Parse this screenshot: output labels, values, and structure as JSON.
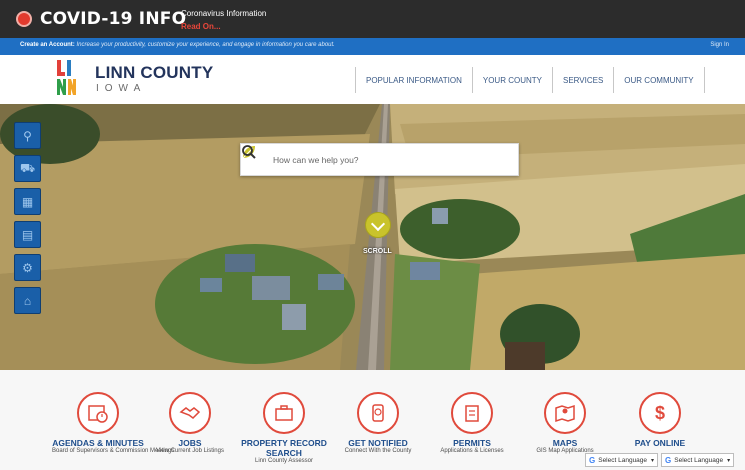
{
  "covid": {
    "title": "COVID-19 INFO",
    "subtitle": "Coronavirus Information",
    "link": "Read On..."
  },
  "account_bar": {
    "create_label": "Create an Account:",
    "message": "Increase your productivity, customize your experience, and engage in information you care about.",
    "sign_in": "Sign In"
  },
  "brand": {
    "name": "LINN COUNTY",
    "sub": "IOWA",
    "logo_letters": [
      "L",
      "I",
      "N",
      "N"
    ]
  },
  "nav": {
    "items": [
      {
        "label": "POPULAR INFORMATION"
      },
      {
        "label": "YOUR COUNTY"
      },
      {
        "label": "SERVICES"
      },
      {
        "label": "OUR COMMUNITY"
      }
    ]
  },
  "hero": {
    "search_placeholder": "How can we help you?",
    "scroll_label": "SCROLL",
    "side_tools": [
      {
        "icon": "map-pin-icon"
      },
      {
        "icon": "truck-icon"
      },
      {
        "icon": "calendar-icon"
      },
      {
        "icon": "document-icon"
      },
      {
        "icon": "gear-icon"
      },
      {
        "icon": "home-icon"
      }
    ]
  },
  "quick_links": [
    {
      "title": "AGENDAS & MINUTES",
      "desc": "Board of Supervisors & Commission Meetings",
      "icon": "calendar-clock-icon"
    },
    {
      "title": "JOBS",
      "desc": "View Current Job Listings",
      "icon": "handshake-icon"
    },
    {
      "title": "PROPERTY RECORD SEARCH",
      "desc": "Linn County Assessor",
      "icon": "briefcase-icon"
    },
    {
      "title": "GET NOTIFIED",
      "desc": "Connect With the County",
      "icon": "phone-notification-icon"
    },
    {
      "title": "PERMITS",
      "desc": "Applications & Licenses",
      "icon": "clipboard-icon"
    },
    {
      "title": "MAPS",
      "desc": "GIS Map Applications",
      "icon": "map-icon"
    },
    {
      "title": "PAY ONLINE",
      "desc": "",
      "icon": "dollar-icon"
    }
  ],
  "translate": {
    "label": "Select Language",
    "label_2": "Select Language"
  },
  "colors": {
    "covid_bar": "#2c2c2c",
    "account_bar": "#1f6fc3",
    "nav_text": "#3b5a86",
    "brand_navy": "#23345c",
    "accent_red": "#e04a3c",
    "scroll_yellow": "#c9c32b"
  }
}
